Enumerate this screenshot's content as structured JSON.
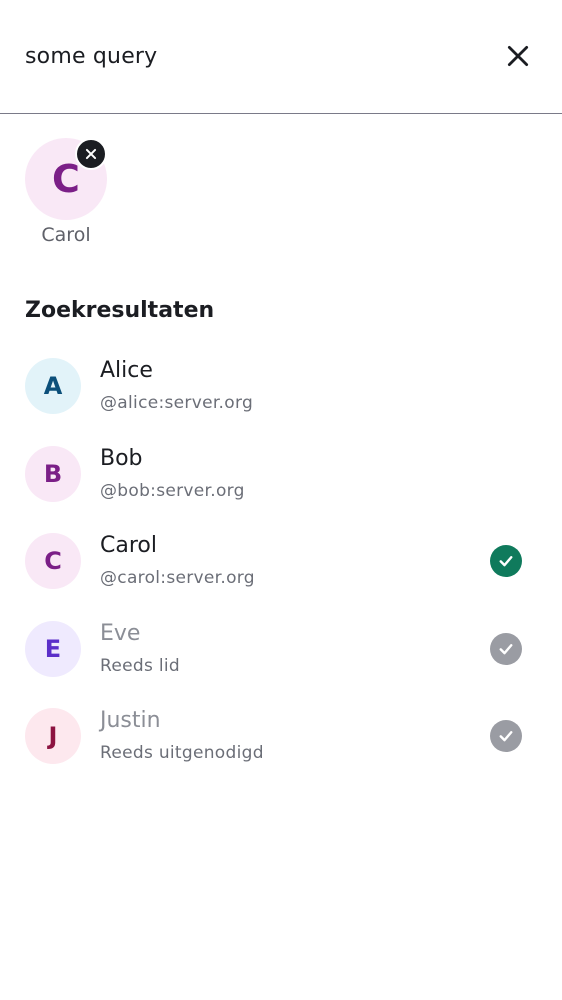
{
  "search": {
    "value": "some query",
    "clear_icon": "close-icon"
  },
  "selected": {
    "initial": "C",
    "name": "Carol",
    "avatar_bg": "#f9e8f6",
    "avatar_fg": "#7b1f87",
    "remove_icon": "close-icon"
  },
  "section": {
    "title": "Zoekresultaten"
  },
  "results": [
    {
      "initial": "A",
      "name": "Alice",
      "subtitle": "@alice:server.org",
      "avatar_bg": "#e2f3f9",
      "avatar_fg": "#0b4f7a",
      "state": "none"
    },
    {
      "initial": "B",
      "name": "Bob",
      "subtitle": "@bob:server.org",
      "avatar_bg": "#f9e8f6",
      "avatar_fg": "#7b1f87",
      "state": "none"
    },
    {
      "initial": "C",
      "name": "Carol",
      "subtitle": "@carol:server.org",
      "avatar_bg": "#f9e8f6",
      "avatar_fg": "#7b1f87",
      "state": "selected"
    },
    {
      "initial": "E",
      "name": "Eve",
      "subtitle": "Reeds lid",
      "avatar_bg": "#efeafe",
      "avatar_fg": "#5b2fc9",
      "state": "disabled"
    },
    {
      "initial": "J",
      "name": "Justin",
      "subtitle": "Reeds uitgenodigd",
      "avatar_bg": "#fde8ee",
      "avatar_fg": "#8c1340",
      "state": "disabled"
    }
  ],
  "colors": {
    "selected_check": "#0f7a5c",
    "disabled_check": "#9a9ca3",
    "text_primary": "#1b1d22",
    "text_secondary": "#6b6e77",
    "divider": "#7a7a88"
  },
  "icons": {
    "check": "check-icon"
  }
}
